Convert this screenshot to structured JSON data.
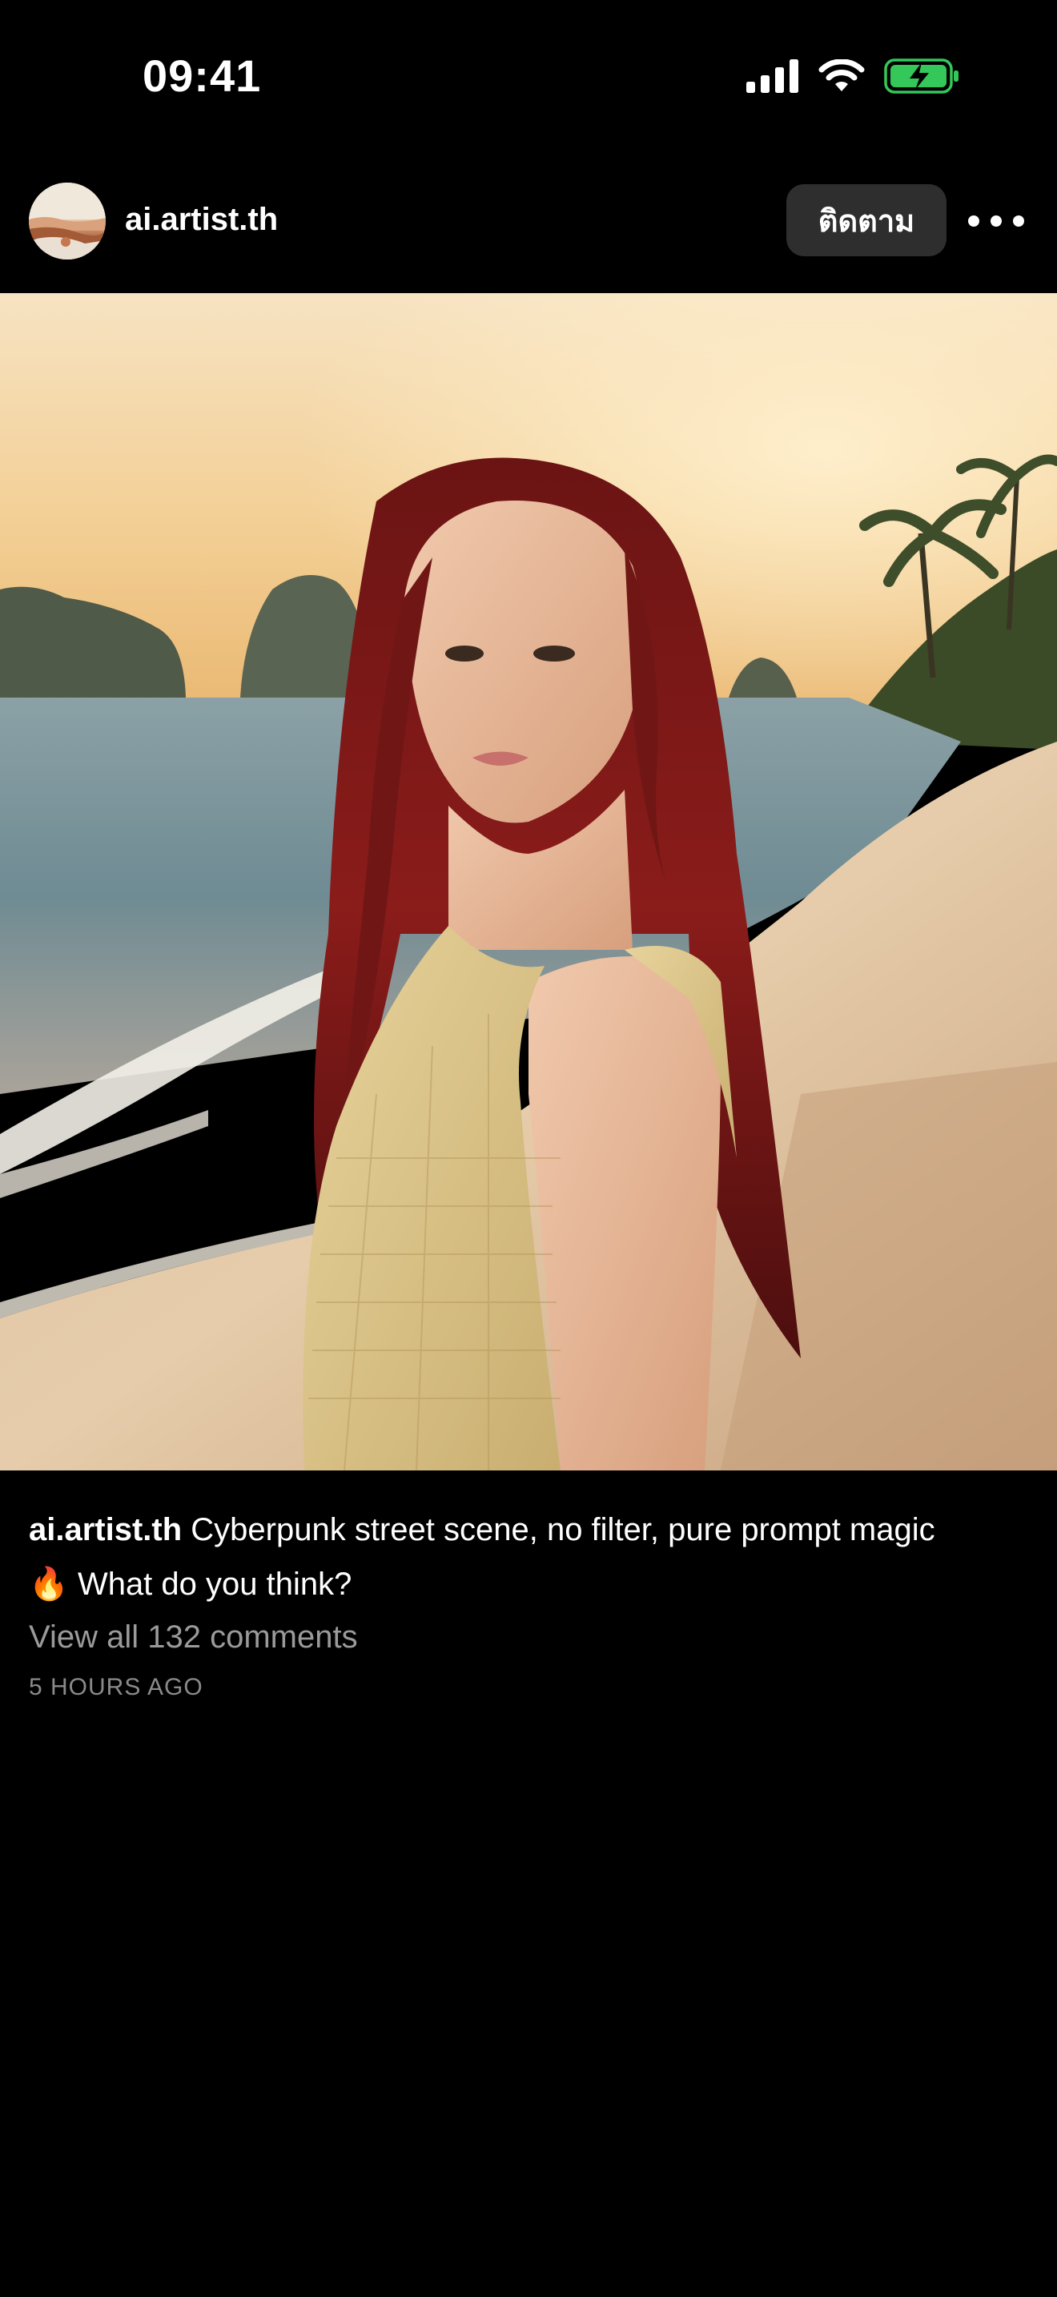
{
  "status_bar": {
    "time": "09:41",
    "icons": [
      "cellular-signal-icon",
      "wifi-icon",
      "battery-charging-icon"
    ],
    "battery_color": "#34c759"
  },
  "post": {
    "username": "ai.artist.th",
    "follow_label": "ติดตาม",
    "more_icon": "more-horizontal-icon",
    "caption_user": "ai.artist.th",
    "caption_text_1": "Cyberpunk street scene, no filter, pure prompt magic",
    "caption_emoji": "🔥",
    "caption_text_2": "What do you think?",
    "comments_label": "View all 132 comments",
    "timestamp": "5 HOURS AGO"
  },
  "colors": {
    "background": "#000000",
    "follow_button_bg": "#2e2e2e",
    "secondary_text": "#9a9a9a"
  }
}
